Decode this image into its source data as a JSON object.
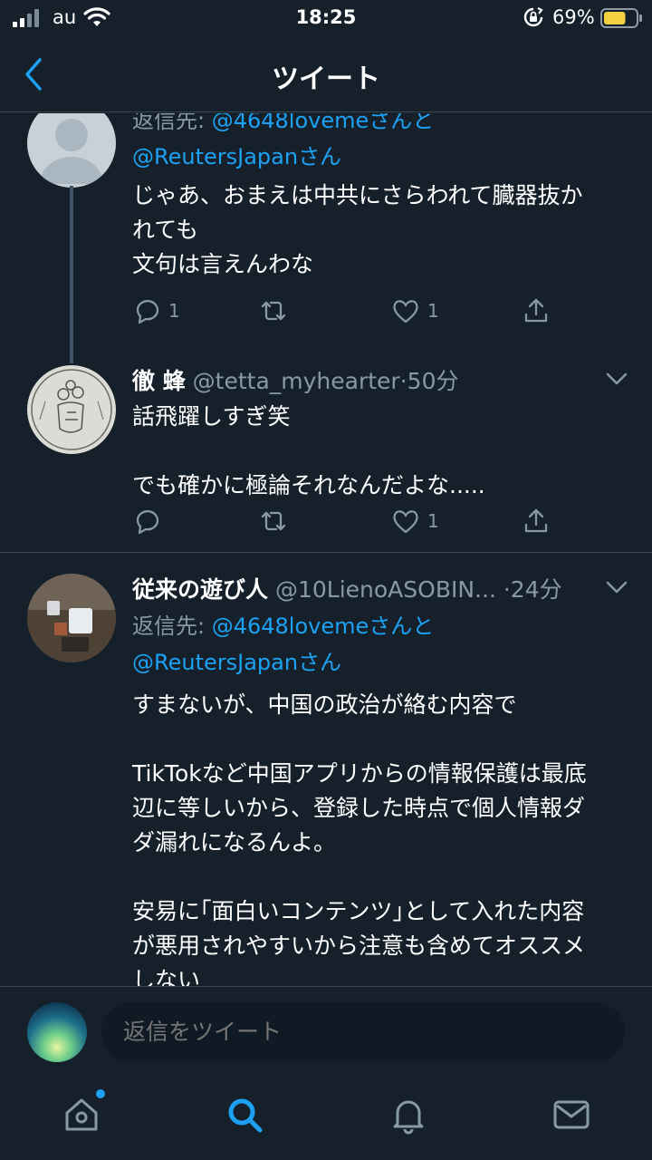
{
  "status_bar": {
    "carrier": "au",
    "time": "18:25",
    "battery_percent": "69%",
    "battery_level": 0.69
  },
  "header": {
    "title": "ツイート"
  },
  "tweets": [
    {
      "reply_to_prefix": "返信先: ",
      "reply_mention_1": "@4648loveme",
      "reply_and": "さんと",
      "reply_mention_2": "@ReutersJapan",
      "reply_san": "さん",
      "text": "じゃあ、おまえは中共にさらわれて臓器抜か\nれても\n文句は言えんわな",
      "reply_count": "1",
      "like_count": "1"
    },
    {
      "name": "徹 蜂",
      "handle": "@tetta_myhearter",
      "separator": "·",
      "time_ago": "50分",
      "text": "話飛躍しすぎ笑\n\nでも確かに極論それなんだよな.....",
      "like_count": "1"
    },
    {
      "name": "従来の遊び人",
      "handle": "@10LienoASOBIN...",
      "separator": "·",
      "time_ago": "24分",
      "reply_to_prefix": "返信先: ",
      "reply_mention_1": "@4648loveme",
      "reply_and": "さんと",
      "reply_mention_2": "@ReutersJapan",
      "reply_san": "さん",
      "text": "すまないが、中国の政治が絡む内容で\n\nTikTokなど中国アプリからの情報保護は最底\n辺に等しいから、登録した時点で個人情報ダ\nダ漏れになるんよ。\n\n安易に｢面白いコンテンツ｣として入れた内容\nが悪用されやすいから注意も含めてオススメ\nしない"
    }
  ],
  "reply_bar": {
    "placeholder": "返信をツイート"
  },
  "tab_bar": {
    "items": [
      "home-icon",
      "search-icon",
      "bell-icon",
      "mail-icon"
    ],
    "active": "search-icon"
  },
  "colors": {
    "background": "#15202b",
    "accent": "#1da1f2",
    "secondary_text": "#8899a6",
    "divider": "#38444d"
  }
}
